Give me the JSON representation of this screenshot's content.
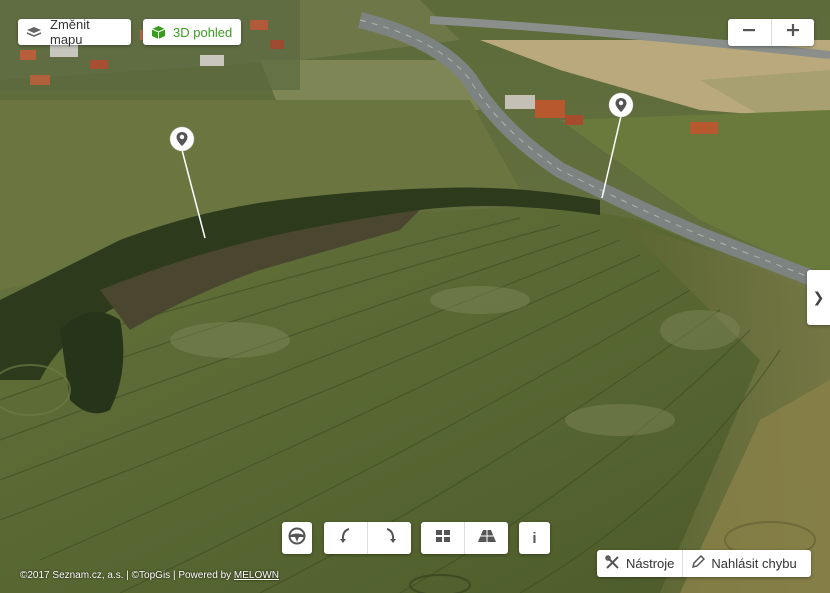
{
  "toolbar": {
    "change_map_label": "Změnit mapu",
    "view3d_label": "3D pohled",
    "view3d_color": "#3a9c1f"
  },
  "zoom": {
    "out_label": "−",
    "in_label": "+"
  },
  "side_panel": {
    "toggle_glyph": "❯"
  },
  "bottom_controls": {
    "info_label": "i",
    "icons": [
      "steering-wheel-icon",
      "rotate-left-icon",
      "rotate-right-icon",
      "grid-view-icon",
      "tilt-view-icon"
    ]
  },
  "tools": {
    "tools_label": "Nástroje",
    "report_label": "Nahlásit chybu"
  },
  "copyright": {
    "text": "©2017 Seznam.cz, a.s. | ©TopGis | Powered by ",
    "link": "MELOWN"
  },
  "map": {
    "markers": [
      "map-pin-icon",
      "map-pin-icon"
    ],
    "colors": {
      "field": "#5c6a35",
      "field_dark": "#3f4d24",
      "road": "#8a8f8c",
      "trees": "#2a3a1c"
    }
  }
}
